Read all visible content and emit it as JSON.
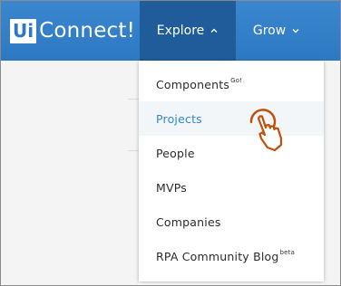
{
  "logo": {
    "badge": "Ui",
    "name": "Connect!"
  },
  "nav": {
    "explore": {
      "label": "Explore",
      "icon": "chevron-up-icon"
    },
    "grow": {
      "label": "Grow",
      "icon": "chevron-down-icon"
    }
  },
  "menu": {
    "items": [
      {
        "label": "Components",
        "sup": "Go!"
      },
      {
        "label": "Projects",
        "sup": ""
      },
      {
        "label": "People",
        "sup": ""
      },
      {
        "label": "MVPs",
        "sup": ""
      },
      {
        "label": "Companies",
        "sup": ""
      },
      {
        "label": "RPA Community Blog",
        "sup": "beta"
      }
    ],
    "active_index": 1
  },
  "colors": {
    "header": "#2d78c2",
    "nav_active": "#1f5c99",
    "link_active": "#2e88c9",
    "cursor": "#c0510c"
  },
  "cursor": {
    "icon": "hand-pointer-click-icon"
  }
}
